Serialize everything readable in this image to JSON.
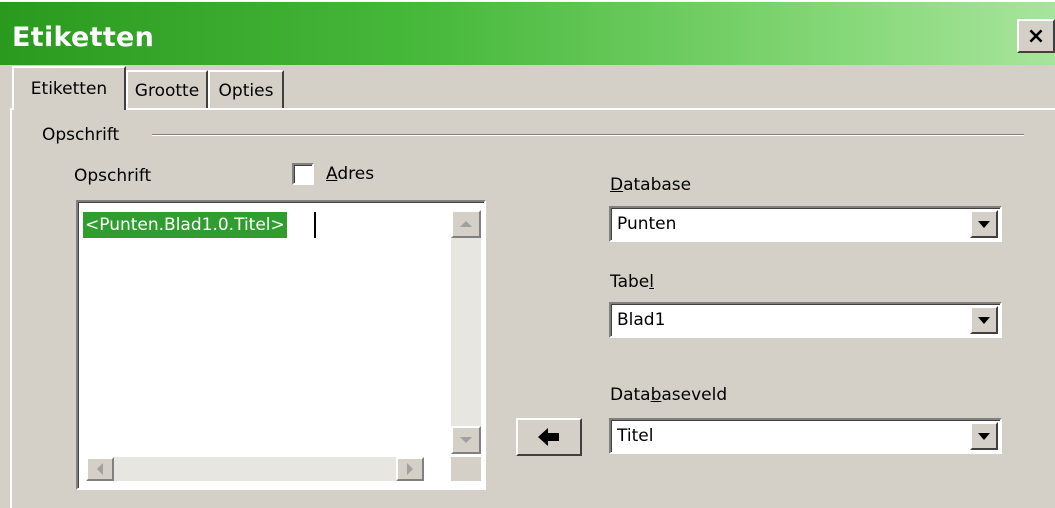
{
  "window": {
    "title": "Etiketten",
    "close_label": "×"
  },
  "tabs": [
    {
      "label": "Etiketten",
      "active": true
    },
    {
      "label": "Grootte",
      "active": false
    },
    {
      "label": "Opties",
      "active": false
    }
  ],
  "group": {
    "label": "Opschrift"
  },
  "inscription": {
    "label": "Opschrift",
    "text": "<Punten.Blad1.0.Titel>"
  },
  "address_checkbox": {
    "mnemonic": "A",
    "rest": "dres",
    "checked": false
  },
  "database": {
    "label_mnemonic": "D",
    "label_rest": "atabase",
    "value": "Punten"
  },
  "table": {
    "label_pre": "Tabe",
    "label_mnemonic": "l",
    "value": "Blad1"
  },
  "database_field": {
    "label_pre": "Data",
    "label_mnemonic": "b",
    "label_rest": "aseveld",
    "value": "Titel"
  },
  "icons": {
    "close": "close-icon",
    "insert": "arrow-left-icon",
    "dropdown": "chevron-down-icon"
  },
  "colors": {
    "titlebar_start": "#2a9a1e",
    "titlebar_end": "#a8e49c",
    "selection": "#2f9e2f"
  }
}
